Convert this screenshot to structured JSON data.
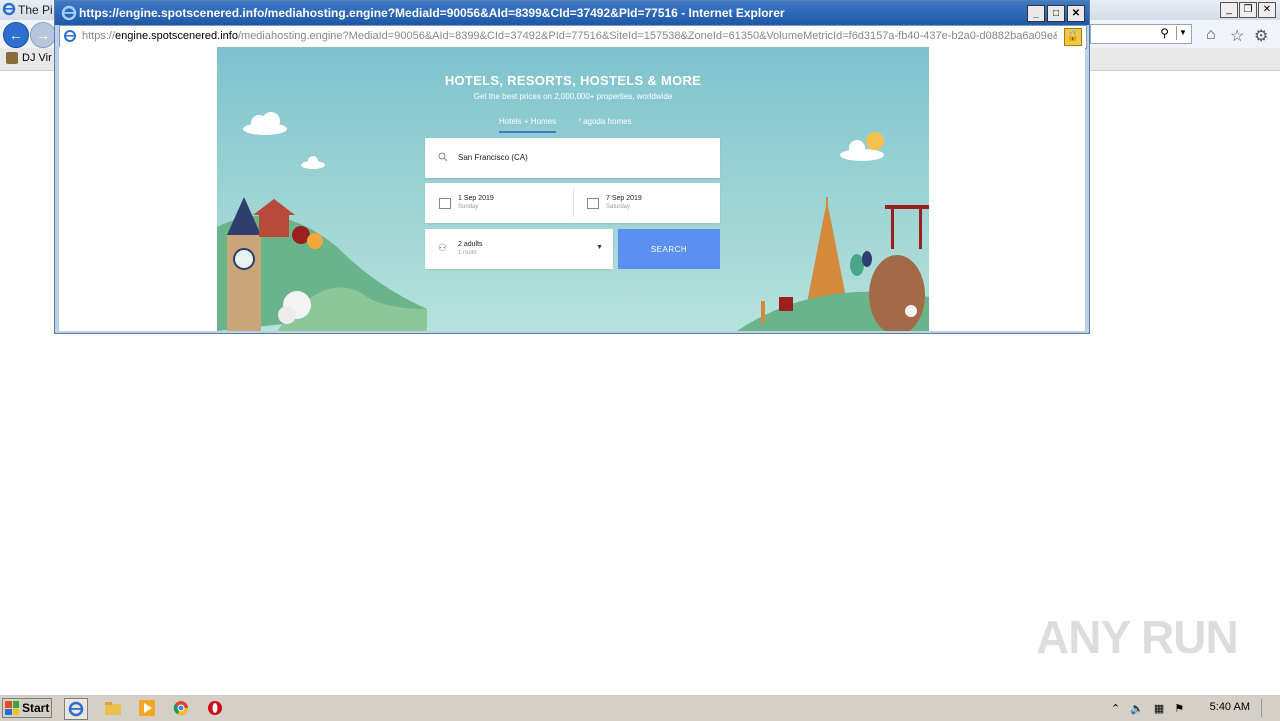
{
  "background_window": {
    "title": "The Pi",
    "favorites": [
      {
        "label": "DJ Vir"
      }
    ]
  },
  "popup": {
    "title": "https://engine.spotscenered.info/mediahosting.engine?MediaId=90056&AId=8399&CId=37492&PId=77516 - Internet Explorer",
    "address": {
      "scheme": "https://",
      "host": "engine.spotscenered.info",
      "path": "/mediahosting.engine?MediaId=90056&AId=8399&CId=37492&PId=77516&SiteId=157538&ZoneId=61350&VolumeMetricId=f6d3157a-fb40-437e-b2a0-d0882ba6a09e&"
    }
  },
  "ad": {
    "headline": "HOTELS, RESORTS, HOSTELS & MORE",
    "subheadline": "Get the best prices on 2,000,000+ properties, worldwide",
    "tabs": [
      {
        "label": "Hotels + Homes",
        "active": true
      },
      {
        "label": "agoda homes",
        "active": false
      }
    ],
    "destination": "San Francisco (CA)",
    "checkin": {
      "date": "1 Sep 2019",
      "weekday": "Sunday"
    },
    "checkout": {
      "date": "7 Sep 2019",
      "weekday": "Saturday"
    },
    "guests": {
      "adults": "2 adults",
      "rooms": "1 room"
    },
    "search_label": "SEARCH",
    "colors": {
      "sky": "#7ec2ce",
      "search_button": "#5b8ff2",
      "tab_underline": "#3d7ec2"
    }
  },
  "taskbar": {
    "start_label": "Start",
    "clock": "5:40 AM"
  },
  "watermark": "ANY RUN"
}
